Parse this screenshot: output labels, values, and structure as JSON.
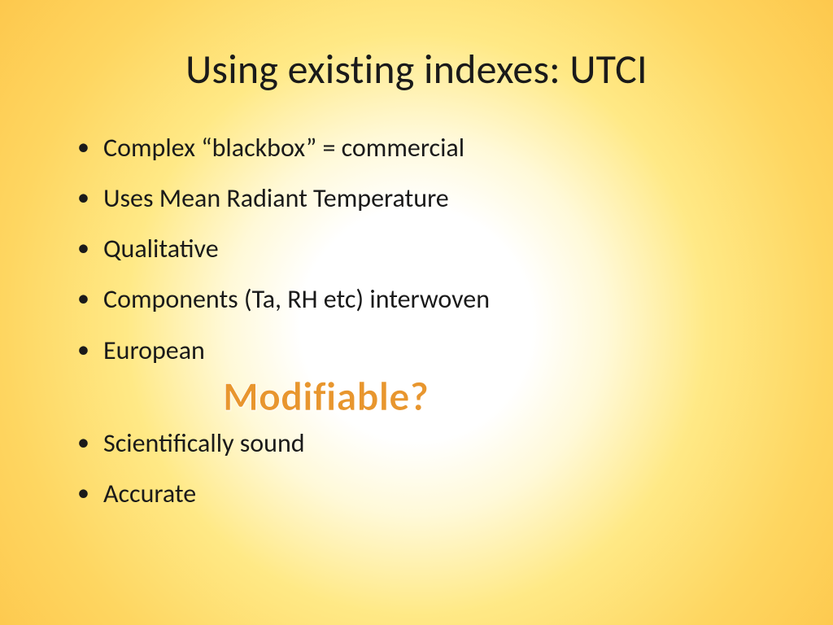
{
  "slide": {
    "title": "Using existing indexes: UTCI",
    "bullets_top": [
      "Complex “blackbox” = commercial",
      "Uses Mean Radiant Temperature",
      "Qualitative",
      "Components (Ta, RH etc) interwoven",
      "European"
    ],
    "bullets_bottom": [
      "Scientifically sound",
      "Accurate"
    ],
    "callout": "Modifiable?"
  }
}
